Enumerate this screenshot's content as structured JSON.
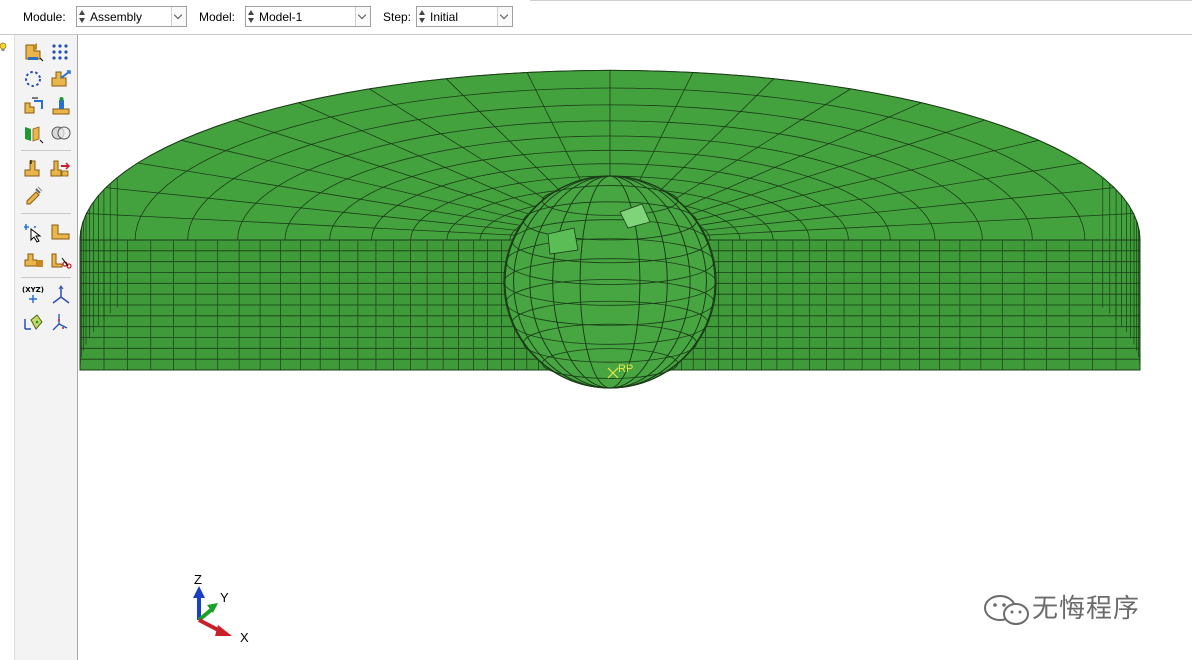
{
  "context_bar": {
    "module_label": "Module:",
    "module_value": "Assembly",
    "model_label": "Model:",
    "model_value": "Model-1",
    "step_label": "Step:",
    "step_value": "Initial"
  },
  "viewport": {
    "reference_point_label": "RP",
    "part_color": "#3f9a3a",
    "mesh_line_color": "#1a3d17"
  },
  "triad": {
    "z_label": "Z",
    "y_label": "Y",
    "x_label": "X",
    "x_color": "#c8202a",
    "y_color": "#1aa024",
    "z_color": "#1a3fc4"
  },
  "toolbox": {
    "icons": [
      "instance-part-icon",
      "instance-array-icon",
      "create-feature-icon",
      "translate-instance-icon",
      "rotate-instance-icon",
      "position-constraint-icon",
      "merge-cut-icon",
      "boolean-icon",
      "create-datum-point-icon",
      "linear-pattern-icon",
      "radial-pattern-icon",
      "set-query-icon",
      "surface-icon",
      "coordinate-system-icon",
      "datum-axis-icon",
      "xyz-point-icon",
      "datum-csys-icon",
      "move-icon",
      "measure-icon"
    ]
  },
  "watermark": {
    "text": "无悔程序"
  }
}
